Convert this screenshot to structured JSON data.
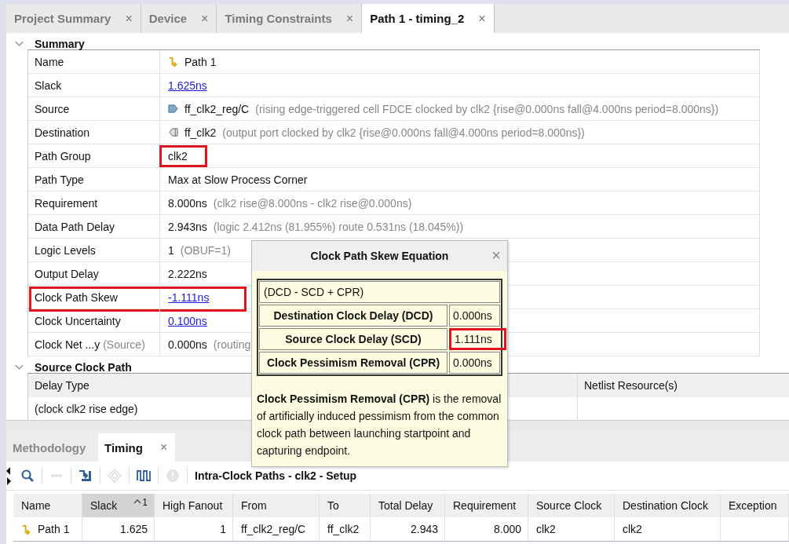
{
  "editor_tabs": [
    {
      "label": "Project Summary",
      "selected": false,
      "close": "×"
    },
    {
      "label": "Device",
      "selected": false,
      "close": "×"
    },
    {
      "label": "Timing Constraints",
      "selected": false,
      "close": "×"
    },
    {
      "label": "Path 1 - timing_2",
      "selected": true,
      "close": "×"
    }
  ],
  "summary": {
    "title": "Summary",
    "expanded": true,
    "rows": [
      {
        "label": "Name",
        "value": "Path 1",
        "kind": "path"
      },
      {
        "label": "Slack",
        "value": "1.625ns",
        "kind": "link"
      },
      {
        "label": "Source",
        "value": "ff_clk2_reg/C",
        "kind": "cell",
        "note": "(rising edge-triggered cell FDCE clocked by clk2  {rise@0.000ns fall@4.000ns period=8.000ns})"
      },
      {
        "label": "Destination",
        "value": "ff_clk2",
        "kind": "port",
        "note": "(output port clocked by clk2  {rise@0.000ns fall@4.000ns period=8.000ns})"
      },
      {
        "label": "Path Group",
        "value": "clk2",
        "kind": "text",
        "label_highlighted": false,
        "value_highlighted": true
      },
      {
        "label": "Path Type",
        "value": "Max at Slow Process Corner",
        "kind": "text"
      },
      {
        "label": "Requirement",
        "value": "8.000ns",
        "kind": "text",
        "note": "(clk2 rise@8.000ns - clk2 rise@0.000ns)"
      },
      {
        "label": "Data Path Delay",
        "value": "2.943ns",
        "kind": "text",
        "note": "(logic 2.412ns (81.955%)  route 0.531ns (18.045%))"
      },
      {
        "label": "Logic Levels",
        "value": "1",
        "kind": "text",
        "note": "(OBUF=1)"
      },
      {
        "label": "Output Delay",
        "value": "2.222ns",
        "kind": "text"
      },
      {
        "label": "Clock Path Skew",
        "value": "-1.111ns",
        "kind": "link",
        "label_highlighted": true,
        "value_highlighted": true
      },
      {
        "label": "Clock Uncertainty",
        "value": "0.100ns",
        "kind": "link"
      },
      {
        "label": "Clock Net ...y",
        "label_note": "(Source)",
        "value": "0.000ns",
        "kind": "text",
        "note": "(routing"
      }
    ]
  },
  "source_clock_path": {
    "title": "Source Clock Path",
    "expanded": true,
    "columns": [
      "Delay Type",
      "Netlist Resource(s)"
    ],
    "rows": [
      [
        "(clock clk2 rise edge)",
        ""
      ]
    ]
  },
  "popup": {
    "title": "Clock Path Skew Equation",
    "close": "×",
    "equation": "(DCD - SCD + CPR)",
    "terms": [
      {
        "label": "Destination Clock Delay (DCD)",
        "value": "0.000ns",
        "highlighted": false
      },
      {
        "label": "Source Clock Delay (SCD)",
        "value": "1.111ns",
        "highlighted": true
      },
      {
        "label": "Clock Pessimism Removal (CPR)",
        "value": "0.000ns",
        "highlighted": false
      }
    ],
    "description": "**Clock Pessimism Removal (CPR)** is the removal of artificially induced pessimism from the common clock path between launching startpoint and capturing endpoint."
  },
  "bottom_tabs": [
    {
      "label": "Methodology",
      "selected": false
    },
    {
      "label": "Timing",
      "selected": true,
      "close": "×"
    }
  ],
  "toolbar": {
    "buttons": [
      {
        "kind": "search",
        "disabled": false
      },
      {
        "kind": "collapse",
        "disabled": true
      },
      {
        "kind": "route",
        "disabled": false
      },
      {
        "kind": "diamond",
        "disabled": true
      },
      {
        "kind": "waveform",
        "disabled": false
      },
      {
        "kind": "info",
        "disabled": true
      }
    ],
    "title": "Intra-Clock Paths - clk2 - Setup"
  },
  "paths_table": {
    "columns": [
      {
        "label": "Name",
        "sorted": false
      },
      {
        "label": "Slack",
        "sorted": true,
        "sort_order": "1"
      },
      {
        "label": "High Fanout",
        "sorted": false
      },
      {
        "label": "From",
        "sorted": false
      },
      {
        "label": "To",
        "sorted": false
      },
      {
        "label": "Total Delay",
        "sorted": false
      },
      {
        "label": "Requirement",
        "sorted": false
      },
      {
        "label": "Source Clock",
        "sorted": false
      },
      {
        "label": "Destination Clock",
        "sorted": false
      },
      {
        "label": "Exception",
        "sorted": false
      }
    ],
    "rows": [
      {
        "cells": [
          "Path 1",
          "1.625",
          "1",
          "ff_clk2_reg/C",
          "ff_clk2",
          "2.943",
          "8.000",
          "clk2",
          "clk2",
          ""
        ],
        "selected": false
      }
    ]
  }
}
